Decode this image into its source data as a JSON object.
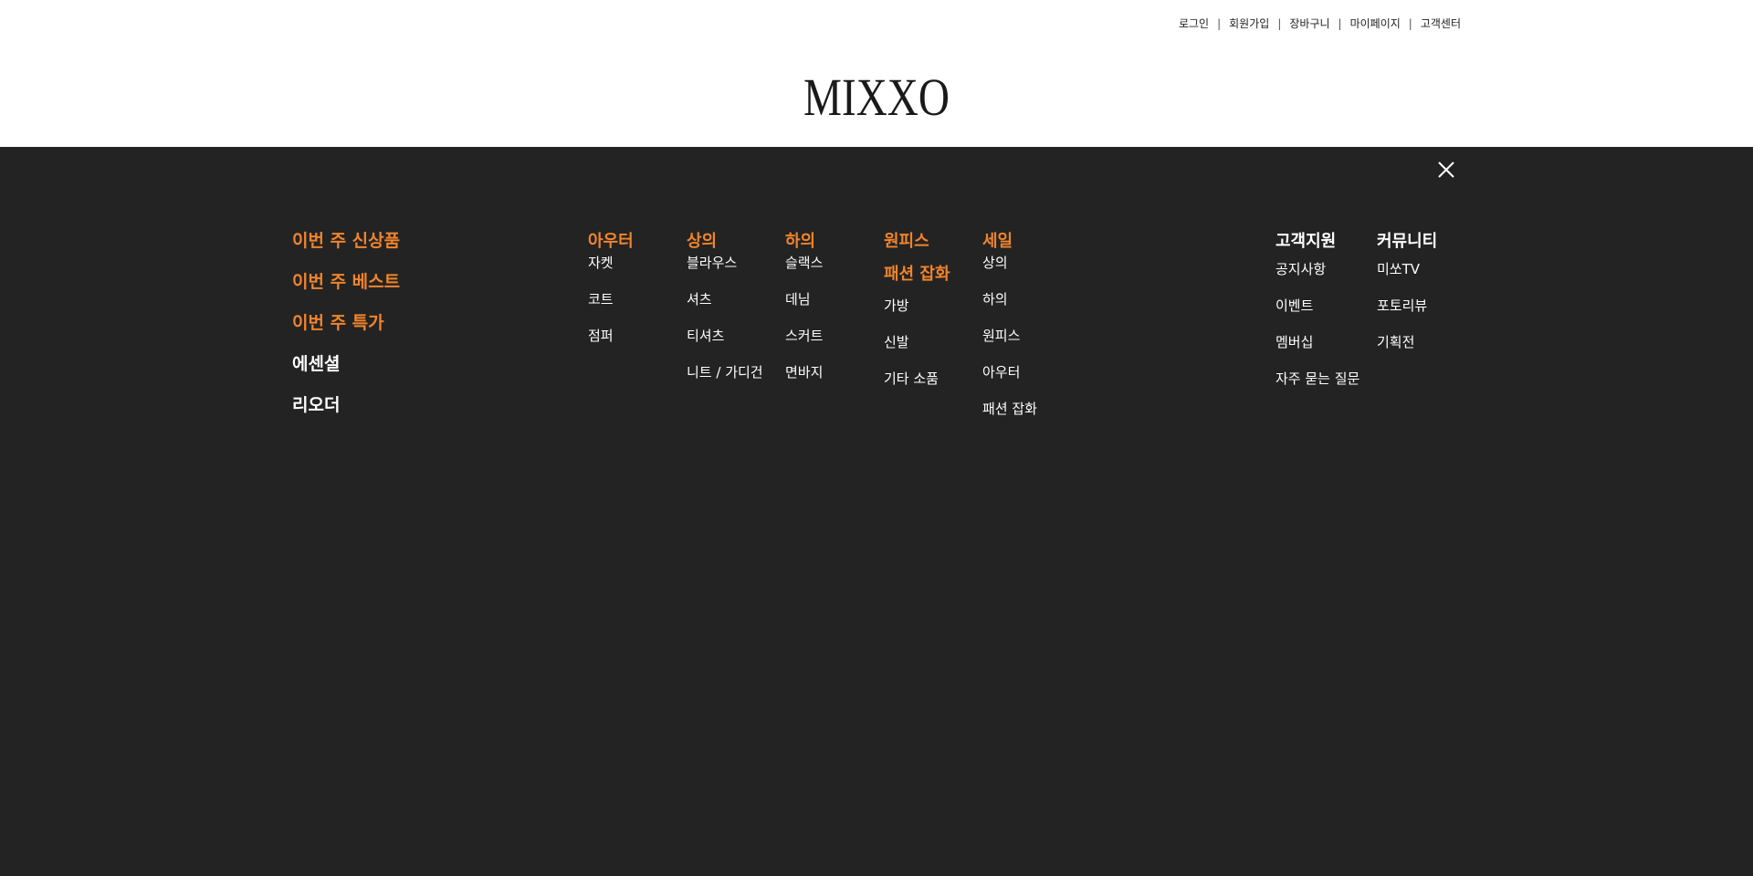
{
  "util_nav": {
    "items": [
      "로그인",
      "회원가입",
      "장바구니",
      "마이페이지",
      "고객센터"
    ],
    "separator": "|"
  },
  "brand": {
    "logo_text": "MIXXO"
  },
  "colors": {
    "accent": "#f0842c",
    "panel_bg": "#232323",
    "header_bg": "#ffffff"
  },
  "featured": [
    {
      "label": "이번 주 신상품"
    },
    {
      "label": "이번 주 베스트"
    },
    {
      "label": "이번 주 특가"
    },
    {
      "label": "에센셜"
    },
    {
      "label": "리오더"
    }
  ],
  "categories": {
    "outer": {
      "title": "아우터",
      "links": [
        "자켓",
        "코트",
        "점퍼"
      ]
    },
    "top": {
      "title": "상의",
      "links": [
        "블라우스",
        "셔츠",
        "티셔츠",
        "니트 / 가디건"
      ]
    },
    "bottom": {
      "title": "하의",
      "links": [
        "슬랙스",
        "데님",
        "스커트",
        "면바지"
      ]
    },
    "onepiece": {
      "title": "원피스"
    },
    "fashion_goods": {
      "title": "패션 잡화",
      "links": [
        "가방",
        "신발",
        "기타 소품"
      ]
    },
    "sale": {
      "title": "세일",
      "links": [
        "상의",
        "하의",
        "원피스",
        "아우터",
        "패션 잡화"
      ]
    }
  },
  "support": {
    "title": "고객지원",
    "links": [
      "공지사항",
      "이벤트",
      "멤버십",
      "자주 묻는 질문"
    ]
  },
  "community": {
    "title": "커뮤니티",
    "links": [
      "미쏘TV",
      "포토리뷰",
      "기획전"
    ]
  },
  "icons": {
    "close": "close-icon"
  }
}
